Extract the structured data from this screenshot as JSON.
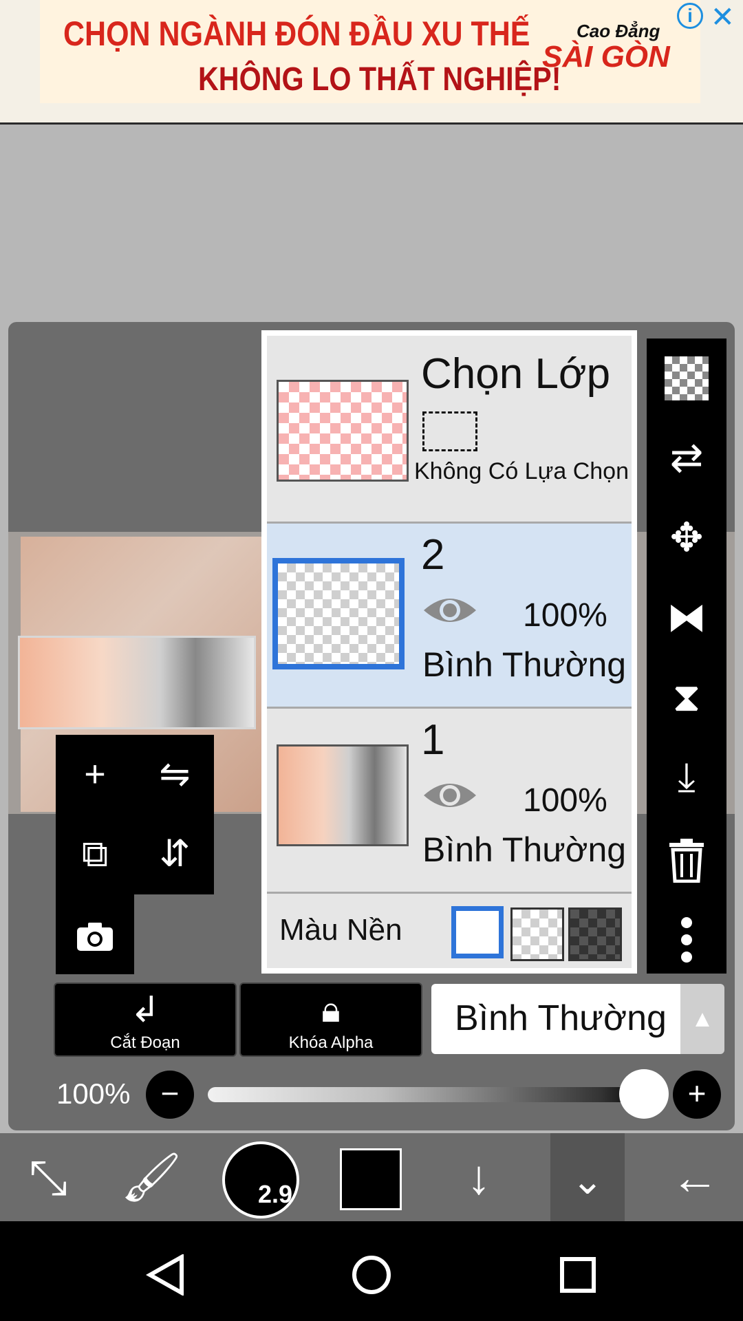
{
  "ad": {
    "line1": "CHỌN NGÀNH ĐÓN ĐẦU XU THẾ",
    "line2": "KHÔNG LO THẤT NGHIỆP!",
    "brand_top": "Cao Đẳng",
    "brand_main": "SÀI GÒN",
    "info_icon": "info-icon",
    "close_icon": "close-icon"
  },
  "layers_panel": {
    "selection_title": "Chọn Lớp",
    "no_selection_label": "Không Có Lựa Chọn",
    "layers": [
      {
        "number": "2",
        "opacity": "100%",
        "blend_mode": "Bình Thường",
        "selected": true
      },
      {
        "number": "1",
        "opacity": "100%",
        "blend_mode": "Bình Thường",
        "selected": false
      }
    ],
    "background_label": "Màu Nền"
  },
  "bottom_controls": {
    "clip_label": "Cắt Đoạn",
    "alpha_lock_label": "Khóa Alpha",
    "blend_mode_value": "Bình Thường",
    "opacity_value": "100%",
    "opacity_fraction": 1.0
  },
  "toolbar": {
    "brush_size": "2.9"
  },
  "colors": {
    "selected_layer_bg": "#d5e3f3",
    "selected_border": "#2e74d9",
    "panel_bg": "#6c6c6c"
  }
}
